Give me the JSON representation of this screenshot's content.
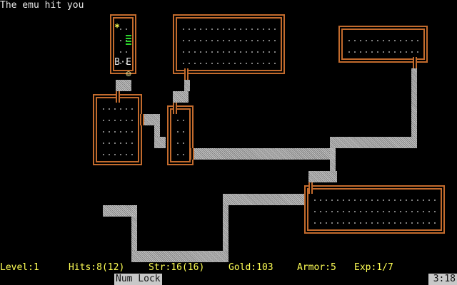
{
  "message": "The emu hit you",
  "status": {
    "level": "Level:1",
    "hits": "Hits:8(12)",
    "strength": "Str:16(16)",
    "gold": "Gold:103",
    "armor": "Armor:5",
    "experience": "Exp:1/7"
  },
  "bottom_bar": {
    "num_lock": "Num Lock",
    "clock": "3:18"
  },
  "glyphs": {
    "gold": "*",
    "bat": "B",
    "emu": "E",
    "player": "☺",
    "floor": "·",
    "stairs": "stairs-icon"
  },
  "colors": {
    "background": "#000000",
    "wall": "#c36b2d",
    "corridor": "#a8a8a8",
    "status_text": "#ffff55",
    "message_text": "#e8e8e8",
    "stairs": "#2bd42b",
    "indicator_bg": "#c8c8c8"
  }
}
